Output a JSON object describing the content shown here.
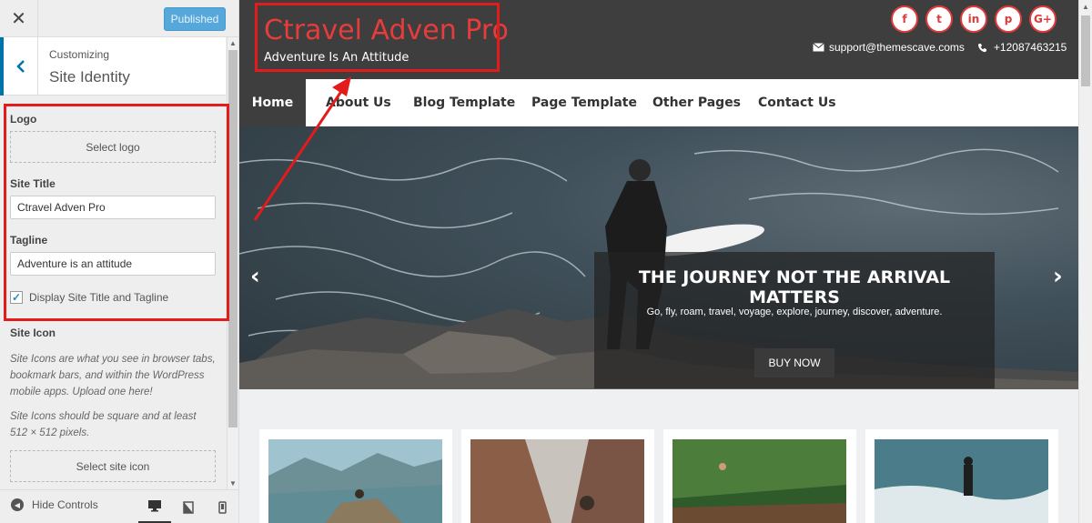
{
  "customizer": {
    "close_glyph": "✕",
    "publish_label": "Published",
    "back_glyph": "‹",
    "breadcrumb_small": "Customizing",
    "section_title": "Site Identity",
    "logo_label": "Logo",
    "select_logo_label": "Select logo",
    "site_title_label": "Site Title",
    "site_title_value": "Ctravel Adven Pro",
    "tagline_label": "Tagline",
    "tagline_value": "Adventure is an attitude",
    "display_checkbox_label": "Display Site Title and Tagline",
    "display_checked": true,
    "site_icon_label": "Site Icon",
    "site_icon_desc1": "Site Icons are what you see in browser tabs, bookmark bars, and within the WordPress mobile apps. Upload one here!",
    "site_icon_desc2": "Site Icons should be square and at least 512 × 512 pixels.",
    "select_icon_label": "Select site icon",
    "hide_controls_label": "Hide Controls",
    "devices": [
      "desktop-icon",
      "tablet-icon",
      "mobile-icon"
    ]
  },
  "site": {
    "title": "Ctravel Adven Pro",
    "tagline": "Adventure Is An Attitude",
    "socials": [
      {
        "icon": "facebook-icon",
        "glyph": "f"
      },
      {
        "icon": "twitter-icon",
        "glyph": "t"
      },
      {
        "icon": "linkedin-icon",
        "glyph": "in"
      },
      {
        "icon": "pinterest-icon",
        "glyph": "p"
      },
      {
        "icon": "google-plus-icon",
        "glyph": "G+"
      }
    ],
    "email": "support@themescave.coms",
    "phone": "+12087463215",
    "nav": [
      "Home",
      "About Us",
      "Blog Template",
      "Page Template",
      "Other Pages",
      "Contact Us"
    ],
    "hero": {
      "title": "THE JOURNEY NOT THE ARRIVAL MATTERS",
      "subtitle": "Go, fly, roam, travel, voyage, explore, journey, discover, adventure.",
      "button": "BUY NOW"
    }
  },
  "colors": {
    "accent": "#e63c3c",
    "wp_blue": "#0073aa",
    "header_bg": "#3e3e3e",
    "annotation": "#e31b1b"
  }
}
